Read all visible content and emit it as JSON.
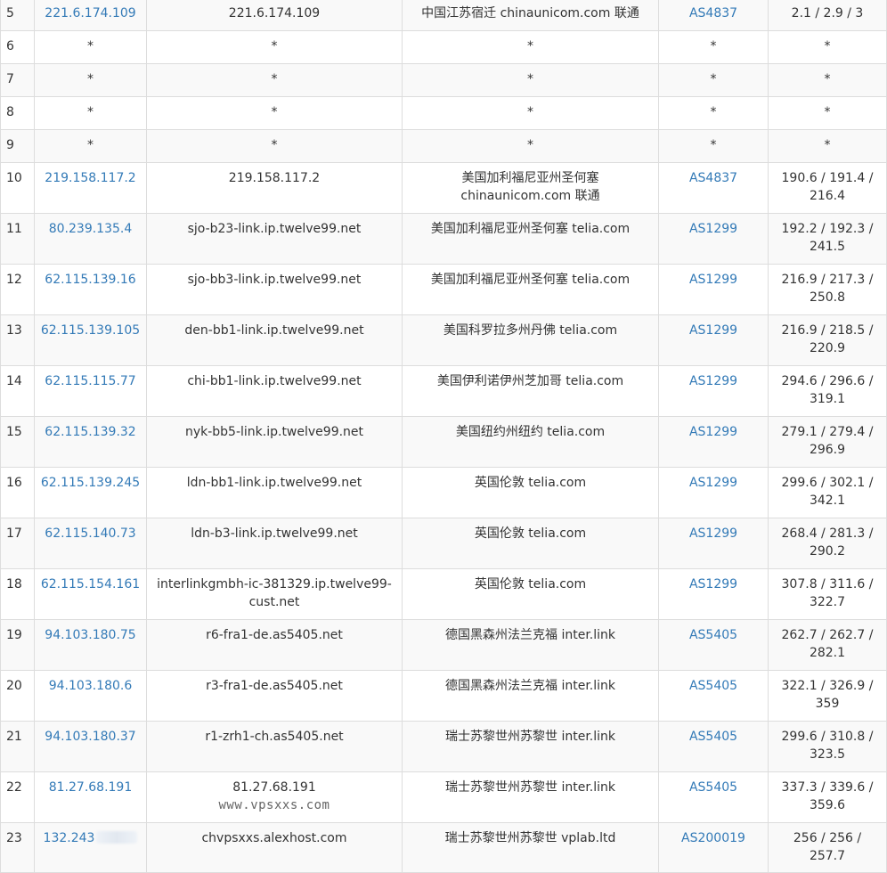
{
  "rows": [
    {
      "hop": "5",
      "ip": "221.6.174.109",
      "host": "221.6.174.109",
      "geo": "中国江苏宿迁 chinaunicom.com 联通",
      "as": "AS4837",
      "rtt": "2.1 / 2.9 / 3"
    },
    {
      "hop": "6",
      "ip": "*",
      "host": "*",
      "geo": "*",
      "as": "*",
      "rtt": "*"
    },
    {
      "hop": "7",
      "ip": "*",
      "host": "*",
      "geo": "*",
      "as": "*",
      "rtt": "*"
    },
    {
      "hop": "8",
      "ip": "*",
      "host": "*",
      "geo": "*",
      "as": "*",
      "rtt": "*"
    },
    {
      "hop": "9",
      "ip": "*",
      "host": "*",
      "geo": "*",
      "as": "*",
      "rtt": "*"
    },
    {
      "hop": "10",
      "ip": "219.158.117.2",
      "host": "219.158.117.2",
      "geo": "美国加利福尼亚州圣何塞 chinaunicom.com 联通",
      "as": "AS4837",
      "rtt": "190.6 / 191.4 / 216.4"
    },
    {
      "hop": "11",
      "ip": "80.239.135.4",
      "host": "sjo-b23-link.ip.twelve99.net",
      "geo": "美国加利福尼亚州圣何塞 telia.com",
      "as": "AS1299",
      "rtt": "192.2 / 192.3 / 241.5"
    },
    {
      "hop": "12",
      "ip": "62.115.139.16",
      "host": "sjo-bb3-link.ip.twelve99.net",
      "geo": "美国加利福尼亚州圣何塞 telia.com",
      "as": "AS1299",
      "rtt": "216.9 / 217.3 / 250.8"
    },
    {
      "hop": "13",
      "ip": "62.115.139.105",
      "host": "den-bb1-link.ip.twelve99.net",
      "geo": "美国科罗拉多州丹佛 telia.com",
      "as": "AS1299",
      "rtt": "216.9 / 218.5 / 220.9"
    },
    {
      "hop": "14",
      "ip": "62.115.115.77",
      "host": "chi-bb1-link.ip.twelve99.net",
      "geo": "美国伊利诺伊州芝加哥 telia.com",
      "as": "AS1299",
      "rtt": "294.6 / 296.6 / 319.1"
    },
    {
      "hop": "15",
      "ip": "62.115.139.32",
      "host": "nyk-bb5-link.ip.twelve99.net",
      "geo": "美国纽约州纽约 telia.com",
      "as": "AS1299",
      "rtt": "279.1 / 279.4 / 296.9"
    },
    {
      "hop": "16",
      "ip": "62.115.139.245",
      "host": "ldn-bb1-link.ip.twelve99.net",
      "geo": "英国伦敦 telia.com",
      "as": "AS1299",
      "rtt": "299.6 / 302.1 / 342.1"
    },
    {
      "hop": "17",
      "ip": "62.115.140.73",
      "host": "ldn-b3-link.ip.twelve99.net",
      "geo": "英国伦敦 telia.com",
      "as": "AS1299",
      "rtt": "268.4 / 281.3 / 290.2"
    },
    {
      "hop": "18",
      "ip": "62.115.154.161",
      "host": "interlinkgmbh-ic-381329.ip.twelve99-cust.net",
      "geo": "英国伦敦 telia.com",
      "as": "AS1299",
      "rtt": "307.8 / 311.6 / 322.7"
    },
    {
      "hop": "19",
      "ip": "94.103.180.75",
      "host": "r6-fra1-de.as5405.net",
      "geo": "德国黑森州法兰克福 inter.link",
      "as": "AS5405",
      "rtt": "262.7 / 262.7 / 282.1"
    },
    {
      "hop": "20",
      "ip": "94.103.180.6",
      "host": "r3-fra1-de.as5405.net",
      "geo": "德国黑森州法兰克福 inter.link",
      "as": "AS5405",
      "rtt": "322.1 / 326.9 / 359"
    },
    {
      "hop": "21",
      "ip": "94.103.180.37",
      "host": "r1-zrh1-ch.as5405.net",
      "geo": "瑞士苏黎世州苏黎世 inter.link",
      "as": "AS5405",
      "rtt": "299.6 / 310.8 / 323.5"
    },
    {
      "hop": "22",
      "ip": "81.27.68.191",
      "host": "81.27.68.191",
      "geo": "瑞士苏黎世州苏黎世 inter.link",
      "as": "AS5405",
      "rtt": "337.3 / 339.6 / 359.6",
      "watermark": "www.vpsxxs.com"
    },
    {
      "hop": "23",
      "ip": "132.243",
      "host": "chvpsxxs.alexhost.com",
      "geo": "瑞士苏黎世州苏黎世 vplab.ltd",
      "as": "AS200019",
      "rtt": "256 / 256 / 257.7",
      "ip_redacted": true
    }
  ],
  "colors": {
    "link": "#337ab7",
    "text": "#333333",
    "border": "#dddddd",
    "stripe": "#f9f9f9"
  }
}
